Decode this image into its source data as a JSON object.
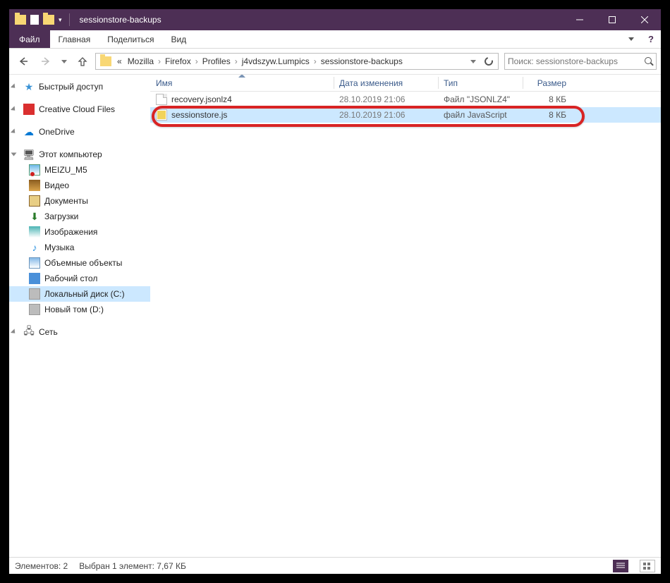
{
  "titlebar": {
    "title": "sessionstore-backups"
  },
  "ribbon": {
    "file": "Файл",
    "tabs": [
      "Главная",
      "Поделиться",
      "Вид"
    ]
  },
  "address": {
    "prefix": "«",
    "crumbs": [
      "Mozilla",
      "Firefox",
      "Profiles",
      "j4vdszyw.Lumpics",
      "sessionstore-backups"
    ]
  },
  "search": {
    "placeholder": "Поиск: sessionstore-backups"
  },
  "sidebar": {
    "quick": "Быстрый доступ",
    "cc": "Creative Cloud Files",
    "onedrive": "OneDrive",
    "thispc": "Этот компьютер",
    "items": [
      "MEIZU_M5",
      "Видео",
      "Документы",
      "Загрузки",
      "Изображения",
      "Музыка",
      "Объемные объекты",
      "Рабочий стол",
      "Локальный диск (C:)",
      "Новый том (D:)"
    ],
    "network": "Сеть"
  },
  "columns": {
    "name": "Имя",
    "date": "Дата изменения",
    "type": "Тип",
    "size": "Размер"
  },
  "files": [
    {
      "name": "recovery.jsonlz4",
      "date": "28.10.2019 21:06",
      "type": "Файл \"JSONLZ4\"",
      "size": "8 КБ",
      "icon": "generic",
      "selected": false
    },
    {
      "name": "sessionstore.js",
      "date": "28.10.2019 21:06",
      "type": "файл JavaScript",
      "size": "8 КБ",
      "icon": "js",
      "selected": true
    }
  ],
  "status": {
    "count": "Элементов: 2",
    "selection": "Выбран 1 элемент: 7,67 КБ"
  }
}
